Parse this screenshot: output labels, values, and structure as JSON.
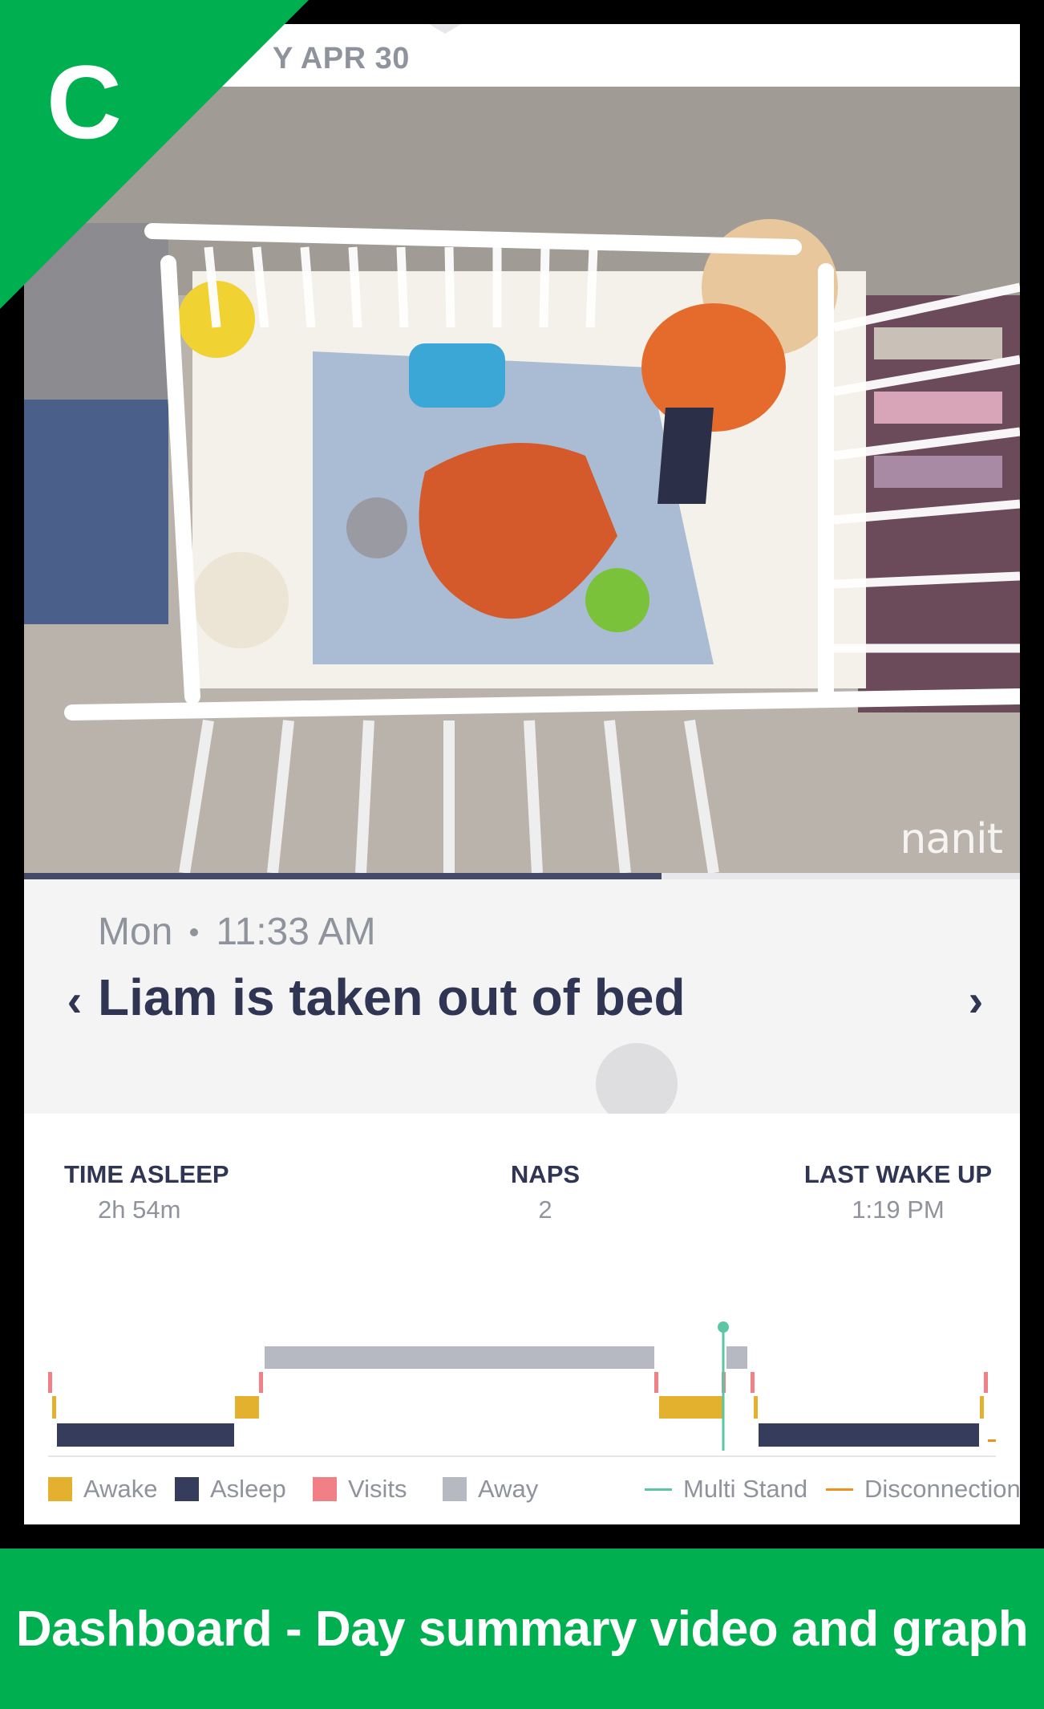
{
  "header": {
    "date_label": "MONDAY APR 30",
    "date_visible": "Y APR 30"
  },
  "video": {
    "watermark": "nanit",
    "progress": 0.64
  },
  "event": {
    "day": "Mon",
    "time": "11:33 AM",
    "title": "Liam is taken out of bed",
    "prev_icon": "chevron-left-icon",
    "next_icon": "chevron-right-icon",
    "prev_glyph": "‹",
    "next_glyph": "›"
  },
  "stats": {
    "time_asleep": {
      "label": "TIME ASLEEP",
      "value": "2h 54m"
    },
    "naps": {
      "label": "NAPS",
      "value": "2"
    },
    "last_wake_up": {
      "label": "LAST WAKE UP",
      "value": "1:19 PM"
    }
  },
  "legend": {
    "awake": "Awake",
    "asleep": "Asleep",
    "visits": "Visits",
    "away": "Away",
    "multi_stand": "Multi Stand",
    "disconnection": "Disconnection"
  },
  "colors": {
    "awake": "#e4b12e",
    "asleep": "#363d5c",
    "visits": "#f07f86",
    "away": "#b6b8c2",
    "multi_stand": "#5bc6a3",
    "disconnection": "#f0901e",
    "banner": "#00b050"
  },
  "badge": {
    "letter": "C"
  },
  "footer": {
    "caption": "Dashboard - Day summary video and graph"
  }
}
